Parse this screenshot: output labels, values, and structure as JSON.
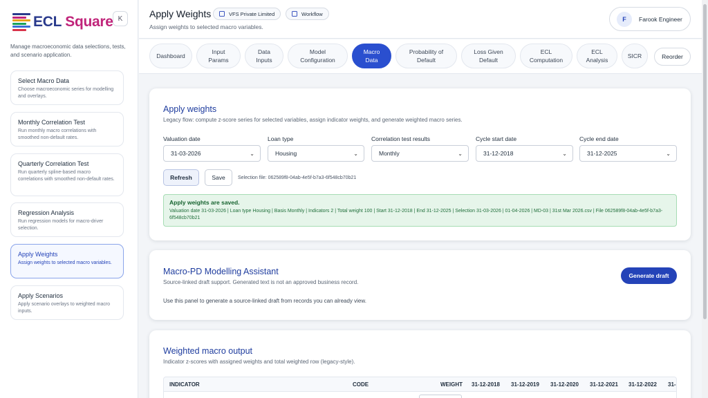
{
  "brand": {
    "ecl": "ECL",
    "square": "Square",
    "colors": [
      "#2a3a8c",
      "#c0247a",
      "#e8a21a",
      "#1aa35a",
      "#3b6fd8",
      "#d8344a"
    ]
  },
  "sidebar": {
    "collapse_label": "K",
    "description": "Manage macroeconomic data selections, tests, and scenario application.",
    "items": [
      {
        "title": "Select Macro Data",
        "desc": "Choose macroeconomic series for modelling and overlays."
      },
      {
        "title": "Monthly Correlation Test",
        "desc": "Run monthly macro correlations with smoothed non-default rates."
      },
      {
        "title": "Quarterly Correlation Test",
        "desc": "Run quarterly spline-based macro correlations with smoothed non-default rates."
      },
      {
        "title": "Regression Analysis",
        "desc": "Run regression models for macro-driver selection."
      },
      {
        "title": "Apply Weights",
        "desc": "Assign weights to selected macro variables."
      },
      {
        "title": "Apply Scenarios",
        "desc": "Apply scenario overlays to weighted macro inputs."
      }
    ],
    "active_index": 4
  },
  "header": {
    "title": "Apply Weights",
    "subtitle": "Assign weights to selected macro variables.",
    "company_chip": "VFS Private Limited",
    "workflow_chip": "Workflow",
    "user_initial": "F",
    "user_name": "Farook Engineer"
  },
  "tabs": [
    {
      "label": "Dashboard"
    },
    {
      "label": "Input\nParams"
    },
    {
      "label": "Data\nInputs"
    },
    {
      "label": "Model\nConfiguration"
    },
    {
      "label": "Macro\nData",
      "active": true
    },
    {
      "label": "Probability of\nDefault"
    },
    {
      "label": "Loss Given\nDefault"
    },
    {
      "label": "ECL\nComputation"
    },
    {
      "label": "ECL\nAnalysis"
    },
    {
      "label": "SICR"
    }
  ],
  "reorder_label": "Reorder",
  "apply_weights": {
    "title": "Apply weights",
    "subtitle": "Legacy flow: compute z-score series for selected variables, assign indicator weights, and generate weighted macro series.",
    "fields": [
      {
        "label": "Valuation date",
        "value": "31-03-2026"
      },
      {
        "label": "Loan type",
        "value": "Housing"
      },
      {
        "label": "Correlation test results",
        "value": "Monthly"
      },
      {
        "label": "Cycle start date",
        "value": "31-12-2018"
      },
      {
        "label": "Cycle end date",
        "value": "31-12-2025"
      }
    ],
    "refresh_label": "Refresh",
    "save_label": "Save",
    "selection_file": "Selection file: 062589f8-04ab-4e5f-b7a3-6f548cb70b21",
    "alert_title": "Apply weights are saved.",
    "alert_detail": "Valuation date 31-03-2026 | Loan type Housing | Basis Monthly | Indicators 2 | Total weight 100 | Start 31-12-2018 | End 31-12-2025 | Selection 31-03-2026 | 01-04-2026 | MD-03 | 31st Mar 2026.csv | File 062589f8-04ab-4e5f-b7a3-6f548cb70b21"
  },
  "assistant": {
    "title": "Macro-PD Modelling Assistant",
    "subtitle": "Source-linked draft support. Generated text is not an approved business record.",
    "note": "Use this panel to generate a source-linked draft from records you can already view.",
    "generate_label": "Generate draft"
  },
  "output": {
    "title": "Weighted macro output",
    "subtitle": "Indicator z-scores with assigned weights and total weighted row (legacy-style).",
    "columns": [
      "INDICATOR",
      "CODE",
      "WEIGHT",
      "31-12-2018",
      "31-12-2019",
      "31-12-2020",
      "31-12-2021",
      "31-12-2022",
      "31-"
    ]
  }
}
